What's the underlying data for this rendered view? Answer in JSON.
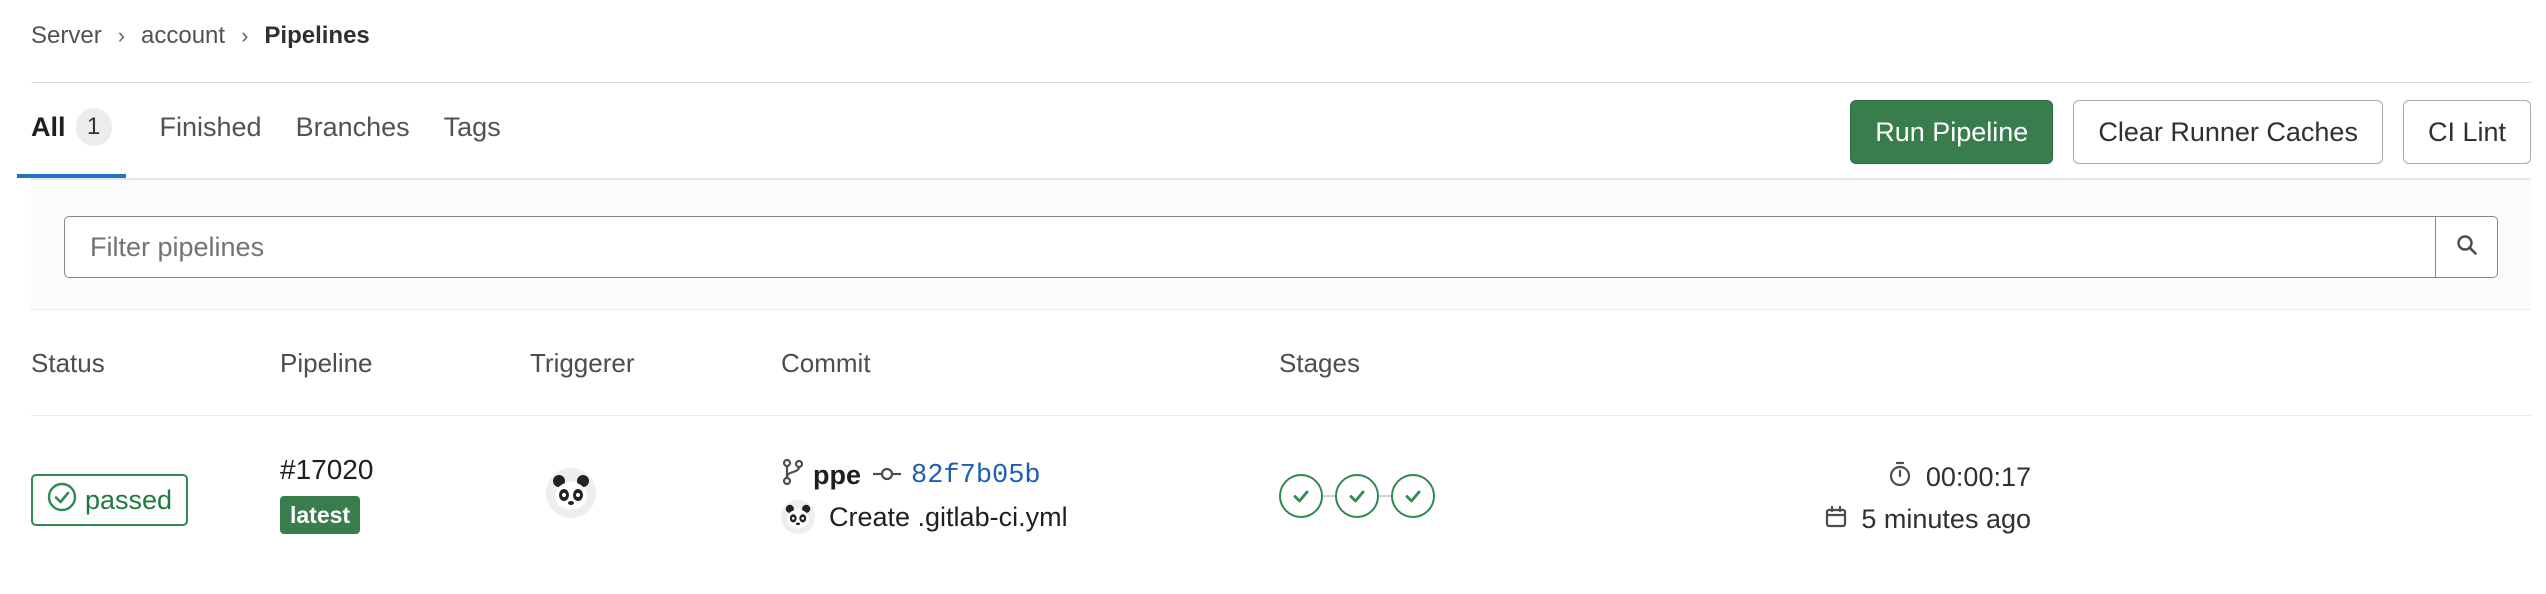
{
  "breadcrumb": {
    "items": [
      "Server",
      "account"
    ],
    "current": "Pipelines"
  },
  "tabs": [
    {
      "label": "All",
      "count": "1",
      "active": true
    },
    {
      "label": "Finished"
    },
    {
      "label": "Branches"
    },
    {
      "label": "Tags"
    }
  ],
  "actions": {
    "run_pipeline": "Run Pipeline",
    "clear_caches": "Clear Runner Caches",
    "ci_lint": "CI Lint"
  },
  "filter": {
    "placeholder": "Filter pipelines",
    "value": ""
  },
  "table": {
    "headers": {
      "status": "Status",
      "pipeline": "Pipeline",
      "triggerer": "Triggerer",
      "commit": "Commit",
      "stages": "Stages"
    },
    "rows": [
      {
        "status": "passed",
        "pipeline_id": "#17020",
        "badge": "latest",
        "ref": "ppe",
        "sha": "82f7b05b",
        "message": "Create .gitlab-ci.yml",
        "stages": [
          "passed",
          "passed",
          "passed"
        ],
        "duration": "00:00:17",
        "finished": "5 minutes ago"
      }
    ]
  },
  "colors": {
    "success": "#2e8a52",
    "primary_button": "#3a7d4d",
    "link": "#1f5fb0",
    "active_tab": "#1f75cb"
  },
  "icons": {
    "status": "check-circle-icon",
    "ref": "branch-icon",
    "commit": "commit-icon",
    "search": "search-icon",
    "duration": "timer-icon",
    "finished": "calendar-icon",
    "avatar": "panda-avatar"
  }
}
